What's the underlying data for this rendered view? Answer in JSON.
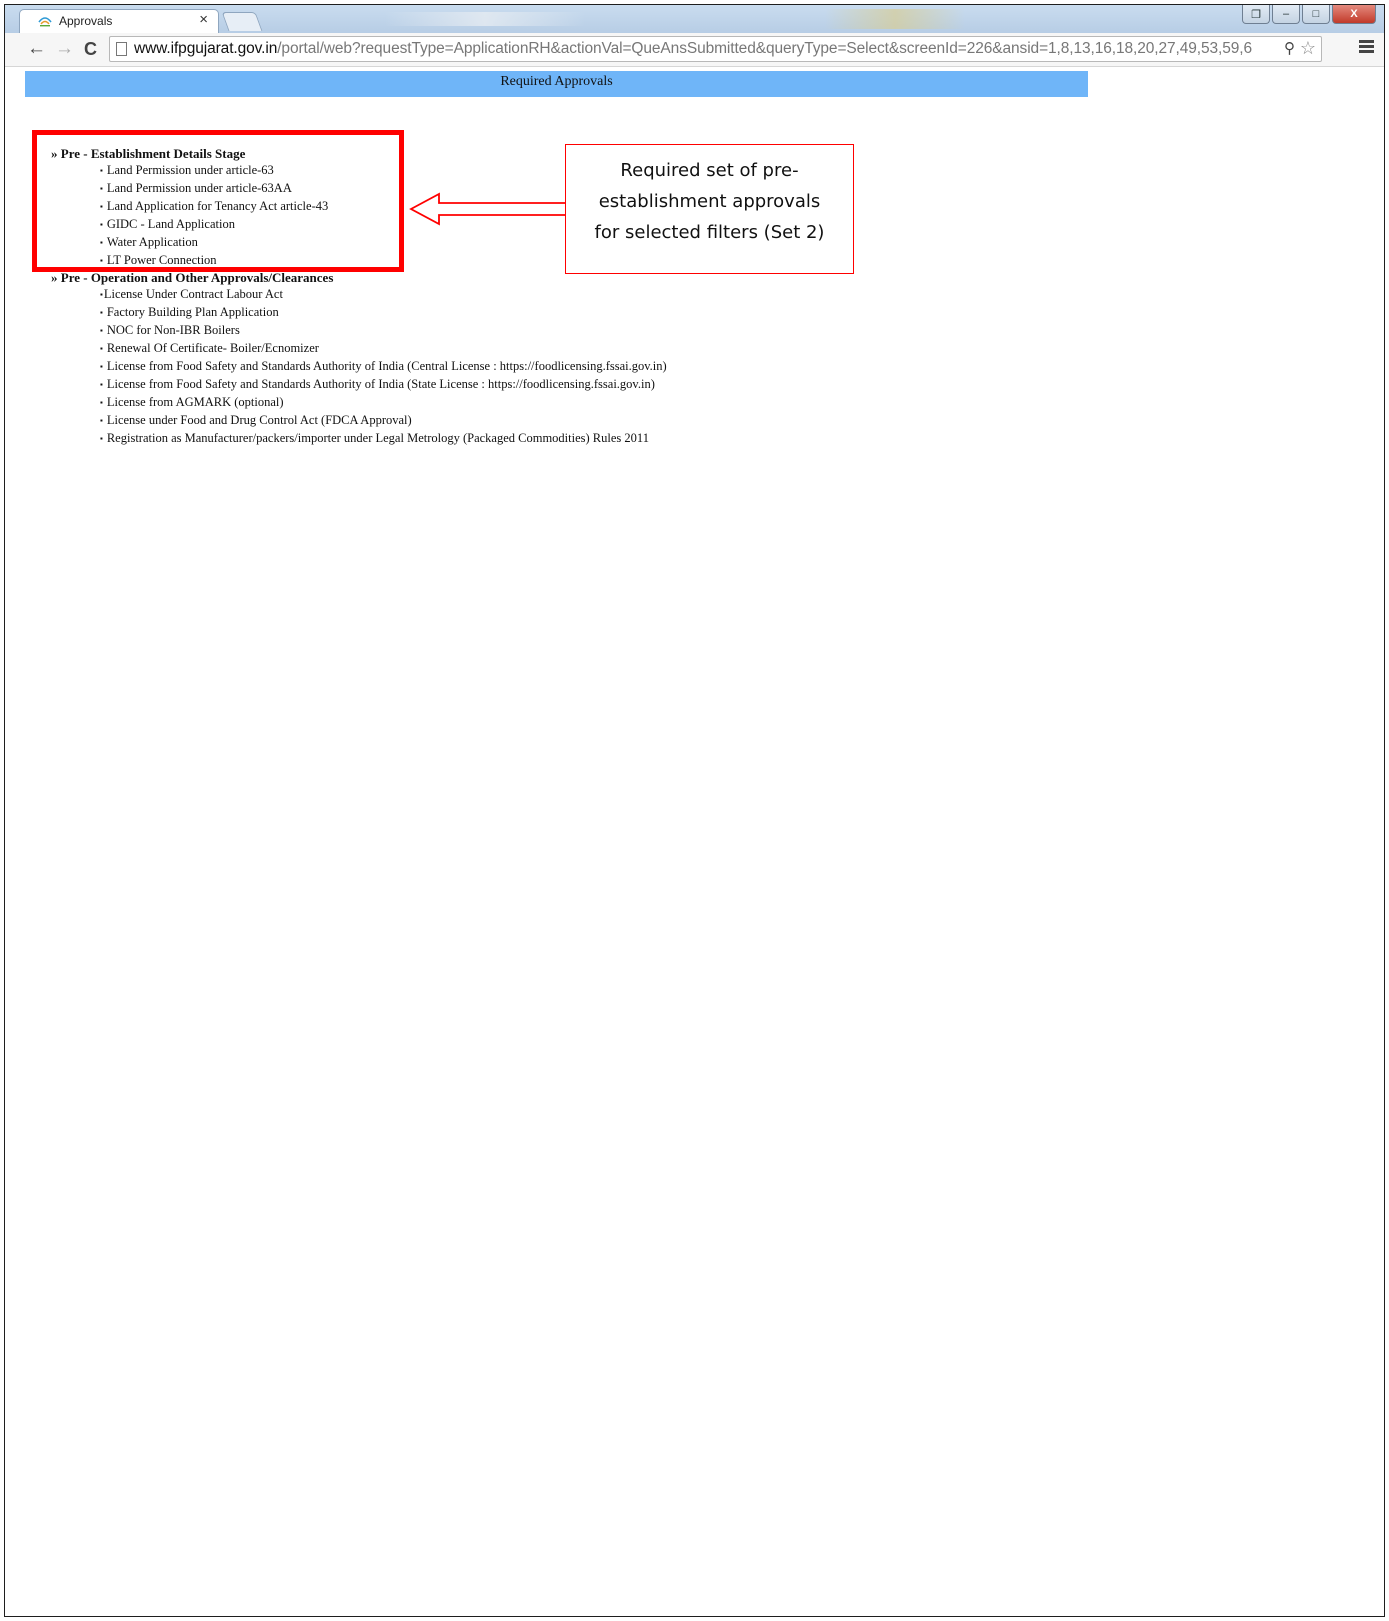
{
  "browser": {
    "tab_title": "Approvals",
    "tab_close": "×",
    "url_host": "www.ifpgujarat.gov.in",
    "url_path": "/portal/web?requestType=ApplicationRH&actionVal=QueAnsSubmitted&queryType=Select&screenId=226&ansid=1,8,13,16,18,20,27,49,53,59,6",
    "window_buttons": {
      "restore_down": "❐",
      "minimize": "–",
      "maximize": "□",
      "close": "X"
    }
  },
  "page": {
    "header": "Required Approvals",
    "stages": [
      {
        "title": "» Pre - Establishment Details Stage",
        "items": [
          "Land Permission under article-63",
          "Land Permission under article-63AA",
          "Land Application for Tenancy Act article-43",
          "GIDC - Land Application",
          "Water Application",
          "LT Power Connection"
        ]
      },
      {
        "title": "» Pre - Operation and Other Approvals/Clearances",
        "items": [
          "License Under Contract Labour Act",
          "Factory Building Plan Application",
          "NOC for Non-IBR Boilers",
          "Renewal Of Certificate- Boiler/Ecnomizer",
          "License from Food Safety and Standards Authority of India (Central License : https://foodlicensing.fssai.gov.in)",
          "License from Food Safety and Standards Authority of India (State License : https://foodlicensing.fssai.gov.in)",
          "License from AGMARK (optional)",
          "License under Food and Drug Control Act (FDCA Approval)",
          "Registration as Manufacturer/packers/importer under Legal Metrology (Packaged Commodities) Rules 2011"
        ]
      }
    ]
  },
  "annotation": {
    "callout_lines": [
      "Required set of pre-",
      "establishment approvals",
      "for selected filters (Set 2)"
    ],
    "color": "#ff0000"
  },
  "colors": {
    "header_bar": "#6fb5f8"
  }
}
